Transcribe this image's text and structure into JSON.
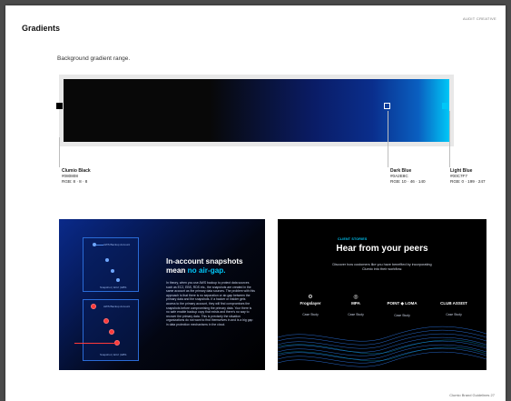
{
  "page": {
    "section_tag": "AUDIT CREATIVE",
    "title": "Gradients",
    "subtitle": "Background gradient range.",
    "footer": "Clumio Brand Guidelines   27"
  },
  "gradient": {
    "swatches": [
      {
        "name": "Clumio Black",
        "hex": "#080808",
        "rgb": "RGB: 8 · 8 · 8"
      },
      {
        "name": "Dark Blue",
        "hex": "#0A2E8C",
        "rgb": "RGB: 10 · 46 · 140"
      },
      {
        "name": "Light Blue",
        "hex": "#00C7F7",
        "rgb": "RGB: 0 · 199 · 247"
      }
    ]
  },
  "card_a": {
    "heading_main": "In-account snapshots mean ",
    "heading_accent": "no air-gap.",
    "body": "In theory, when you use AWS backup to protect data sources such as EC2, EBS, RDS etc., the snapshots are created in the same account as the primary data sources. The problem with this approach is that there is no separation or air-gap between the primary data and the snapshots. If a hacker or insider gets access to the primary account, they will find compromises the snapshots before compromising the primary data. Your there is no safe enable backup copy that exists and there's no way to recover the primary data. This is precisely the situation organizations do not want to find themselves in and is a big gap in data protection mechanisms in the cloud.",
    "mock1_title": "AWS Backup Account",
    "mock2_title": "AWS Backup Account",
    "mock_footer": "Snapshot | EC2 | EBS"
  },
  "card_b": {
    "eyebrow": "CLIENT STORIES",
    "heading": "Hear from your peers",
    "sub": "Discover how customers like you have benefited by incorporating Clumio into their workflow.",
    "logos": [
      {
        "name": "Frogslayer",
        "mark": "⚙",
        "cta": "Case Study"
      },
      {
        "name": "MPA",
        "mark": "◎",
        "cta": "Case Study"
      },
      {
        "name": "POINT ◆ LOMA",
        "mark": "",
        "cta": "Case Study"
      },
      {
        "name": "CLUB ASSIST",
        "mark": "",
        "cta": "Case Study"
      }
    ]
  },
  "colors": {
    "black": "#080808",
    "dark_blue": "#0A2E8C",
    "light_blue": "#00C7F7"
  }
}
